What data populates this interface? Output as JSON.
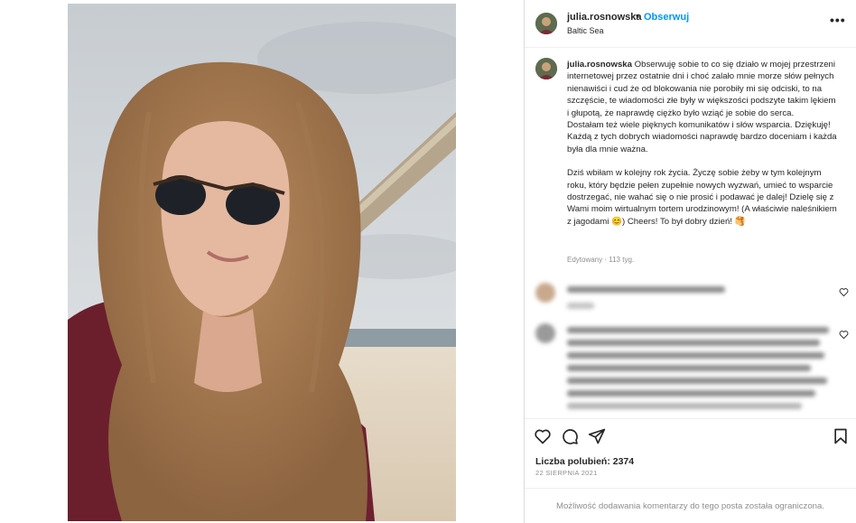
{
  "post": {
    "username": "julia.rosnowska",
    "separator": "•",
    "follow_label": "Obserwuj",
    "location": "Baltic Sea",
    "more_icon": "more-horizontal-icon",
    "caption_paragraphs": [
      "Obserwuję sobie to co się działo w mojej przestrzeni internetowej przez ostatnie dni i choć zalało mnie morze słów pełnych nienawiści i cud że od blokowania nie porobiły mi się odciski, to na szczęście, te wiadomości złe były w większości podszyte takim lękiem i głupotą, że naprawdę ciężko było wziąć je sobie do serca.",
      "Dostałam też wiele pięknych komunikatów i słów wsparcia. Dziękuję! Każdą z tych dobrych wiadomości naprawdę bardzo doceniam i każda była dla mnie ważna.",
      "Dziś wbiłam w kolejny rok życia. Życzę sobie żeby w tym kolejnym roku, który będzie pełen zupełnie nowych wyzwań, umieć to wsparcie dostrzegać, nie wahać się o nie prosić i podawać je dalej! Dzielę się z Wami moim wirtualnym tortem urodzinowym! (A właściwie naleśnikiem z jagodami 😊) Cheers! To był dobry dzień! 🥞"
    ],
    "edited_label": "Edytowany · 113 tyg.",
    "likes_label": "Liczba polubień: 2374",
    "date_label": "22 SIERPNIA 2021",
    "comments_limited": "Możliwość dodawania komentarzy do tego posta została ograniczona."
  },
  "icons": {
    "like": "heart-icon",
    "comment": "comment-icon",
    "share": "send-icon",
    "save": "bookmark-icon"
  },
  "colors": {
    "accent": "#0095f6",
    "text": "#262626",
    "muted": "#8e8e8e",
    "border": "#dbdbdb"
  }
}
